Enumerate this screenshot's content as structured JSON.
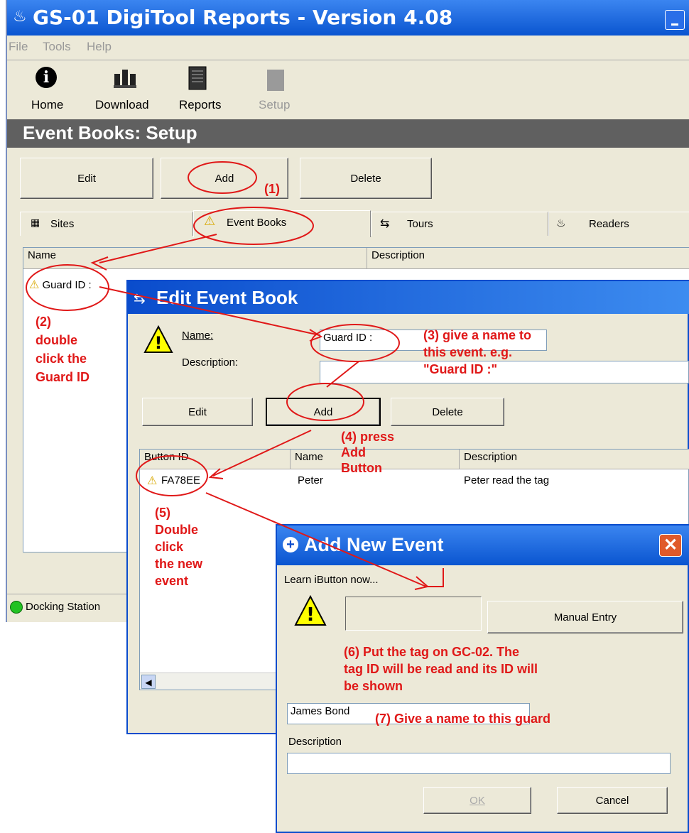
{
  "main": {
    "title": "GS-01 DigiTool Reports - Version 4.08",
    "menu": [
      "File",
      "Tools",
      "Help"
    ],
    "toolbar": {
      "home": "Home",
      "download": "Download",
      "reports": "Reports",
      "setup": "Setup"
    },
    "page_title": "Event Books: Setup",
    "edit": "Edit",
    "add": "Add",
    "delete": "Delete",
    "tabs": {
      "sites": "Sites",
      "event_books": "Event Books",
      "tours": "Tours",
      "readers": "Readers"
    },
    "col_name": "Name",
    "col_description": "Description",
    "row_name": "Guard ID :",
    "status": "Docking Station"
  },
  "edit_dialog": {
    "title": "Edit Event Book",
    "name_label": "Name:",
    "description_label": "Description:",
    "name_value": "Guard ID :",
    "edit": "Edit",
    "add": "Add",
    "delete": "Delete",
    "col_button_id": "Button ID",
    "col_name": "Name",
    "col_description": "Description",
    "row": {
      "button_id": "FA78EE",
      "name": "Peter",
      "description": "Peter read the tag"
    }
  },
  "add_dialog": {
    "title": "Add New Event",
    "learn": "Learn iButton now...",
    "manual_entry": "Manual Entry",
    "name_value": "James Bond",
    "description_label": "Description",
    "ok": "OK",
    "cancel": "Cancel"
  },
  "annotations": {
    "a1": "(1)",
    "a2": [
      "(2)",
      "double",
      "click the",
      "Guard ID"
    ],
    "a3": [
      "(3) give a name to",
      "this event. e.g.",
      "\"Guard ID :\""
    ],
    "a4": [
      "(4) press",
      "Add",
      "Button"
    ],
    "a5": [
      "(5)",
      "Double",
      "click",
      "the new",
      "event"
    ],
    "a6": [
      "(6) Put the tag on GC-02. The",
      "tag ID will be read and its ID will",
      "be shown"
    ],
    "a7": "(7) Give a name to this guard"
  },
  "colors": {
    "title_bar": "#0a5ad8",
    "header_band": "#606060",
    "annotation_red": "#e01818",
    "xp_face": "#ece9d8"
  }
}
